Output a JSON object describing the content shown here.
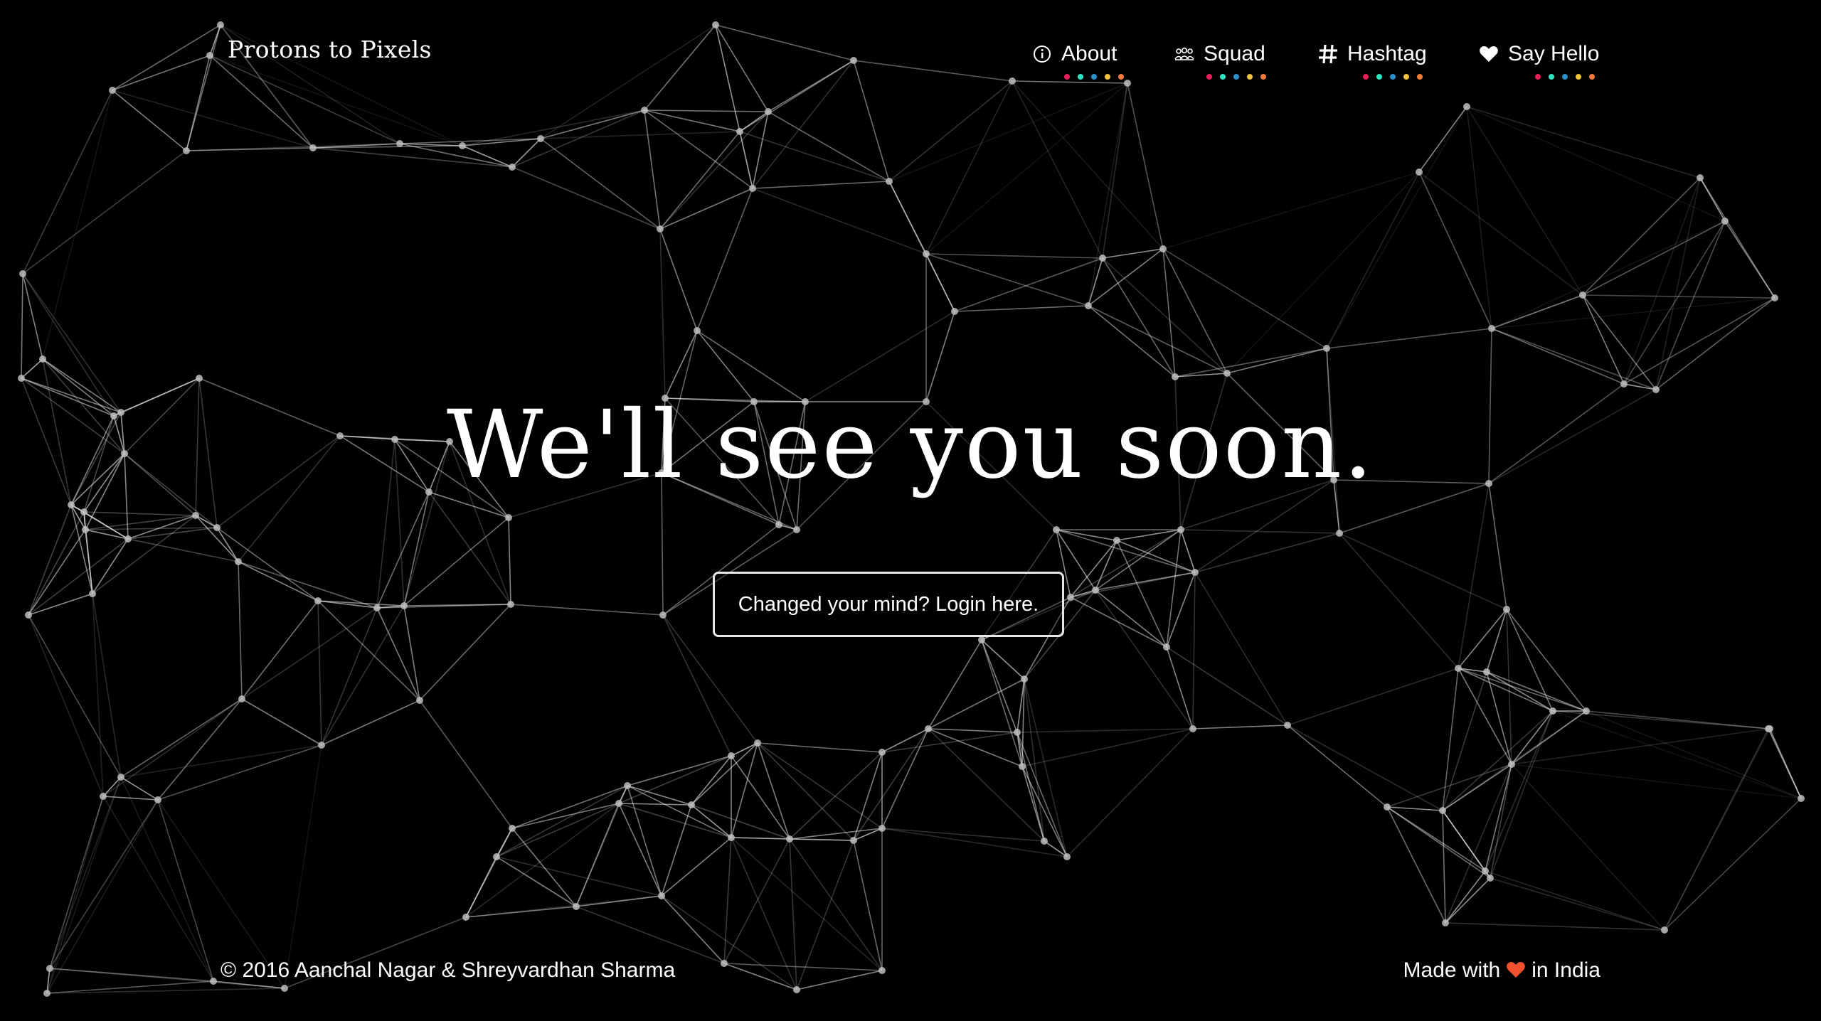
{
  "brand": "Protons to Pixels",
  "nav": [
    {
      "label": "About",
      "icon": "info-icon"
    },
    {
      "label": "Squad",
      "icon": "group-icon"
    },
    {
      "label": "Hashtag",
      "icon": "hashtag-icon"
    },
    {
      "label": "Say Hello",
      "icon": "heart-icon"
    }
  ],
  "nav_dot_colors": [
    "#e8205c",
    "#2ee6c4",
    "#2a8fc9",
    "#f2c23a",
    "#f07c3a"
  ],
  "headline": "We'll see you soon.",
  "login_button": "Changed your mind? Login here.",
  "footer": {
    "copyright": "© 2016 Aanchal Nagar & Shreyvardhan Sharma",
    "made_with": "Made with",
    "in_india": "in India",
    "heart_color": "#f0522e"
  },
  "colors": {
    "background": "#000000",
    "network_node": "#bdbdbd",
    "network_line": "#ffffff"
  }
}
